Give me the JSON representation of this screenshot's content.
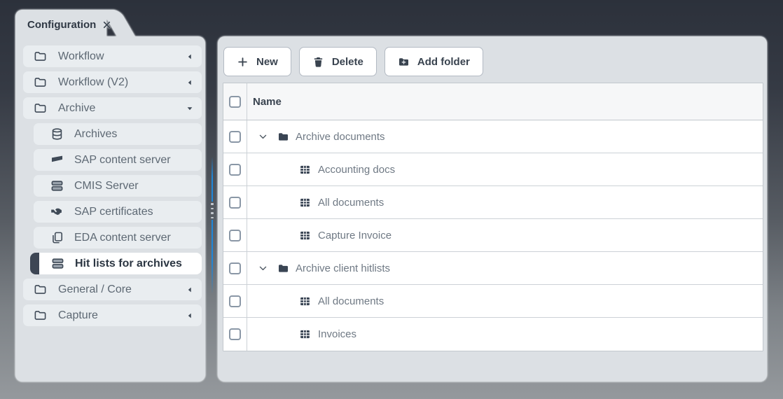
{
  "tab": {
    "label": "Configuration"
  },
  "sidebar": {
    "items": [
      {
        "label": "Workflow",
        "icon": "folder",
        "level": 1,
        "state": "collapsed"
      },
      {
        "label": "Workflow (V2)",
        "icon": "folder",
        "level": 1,
        "state": "collapsed"
      },
      {
        "label": "Archive",
        "icon": "folder",
        "level": 1,
        "state": "expanded"
      },
      {
        "label": "Archives",
        "icon": "database",
        "level": 2
      },
      {
        "label": "SAP content server",
        "icon": "sap-flag",
        "level": 2
      },
      {
        "label": "CMIS Server",
        "icon": "server",
        "level": 2
      },
      {
        "label": "SAP certificates",
        "icon": "handshake",
        "level": 2
      },
      {
        "label": "EDA content server",
        "icon": "copy",
        "level": 2
      },
      {
        "label": "Hit lists for archives",
        "icon": "server",
        "level": 2,
        "selected": true
      },
      {
        "label": "General / Core",
        "icon": "folder",
        "level": 1,
        "state": "collapsed"
      },
      {
        "label": "Capture",
        "icon": "folder",
        "level": 1,
        "state": "collapsed"
      }
    ]
  },
  "toolbar": {
    "new_label": "New",
    "delete_label": "Delete",
    "add_folder_label": "Add folder"
  },
  "table": {
    "name_header": "Name",
    "rows": [
      {
        "label": "Archive documents",
        "icon": "folder",
        "level": 1,
        "expanded": true
      },
      {
        "label": "Accounting docs",
        "icon": "hitlist-grid",
        "level": 2
      },
      {
        "label": "All documents",
        "icon": "hitlist-grid",
        "level": 2
      },
      {
        "label": "Capture Invoice",
        "icon": "hitlist-grid",
        "level": 2
      },
      {
        "label": "Archive client hitlists",
        "icon": "folder",
        "level": 1,
        "expanded": true
      },
      {
        "label": "All documents",
        "icon": "hitlist-grid",
        "level": 2
      },
      {
        "label": "Invoices",
        "icon": "hitlist-grid",
        "level": 2
      }
    ]
  },
  "colors": {
    "accent_blue": "#1f87d9",
    "panel_bg": "#dce0e4",
    "icon_dark": "#3f4a57"
  }
}
